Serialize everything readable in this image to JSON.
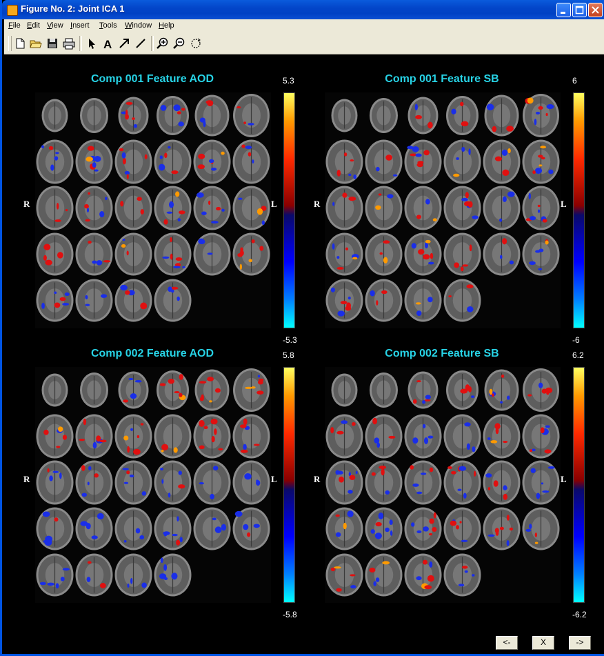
{
  "window": {
    "title": "Figure No. 2: Joint ICA 1"
  },
  "menu": [
    "File",
    "Edit",
    "View",
    "Insert",
    "Tools",
    "Window",
    "Help"
  ],
  "menu_underline": [
    "F",
    "E",
    "V",
    "I",
    "T",
    "W",
    "H"
  ],
  "toolbar": {
    "icons": [
      "new-file-icon",
      "open-folder-icon",
      "save-icon",
      "print-icon",
      "select-arrow-icon",
      "insert-text-icon",
      "insert-arrow-icon",
      "insert-line-icon",
      "zoom-in-icon",
      "zoom-out-icon",
      "rotate-icon"
    ]
  },
  "panels": [
    {
      "title": "Comp 001 Feature AOD",
      "max": "5.3",
      "min": "-5.3",
      "left_label": "R",
      "right_label": "L"
    },
    {
      "title": "Comp 001 Feature SB",
      "max": "6",
      "min": "-6",
      "left_label": "R",
      "right_label": "L"
    },
    {
      "title": "Comp 002 Feature AOD",
      "max": "5.8",
      "min": "-5.8",
      "left_label": "R",
      "right_label": "L"
    },
    {
      "title": "Comp 002 Feature SB",
      "max": "6.2",
      "min": "-6.2",
      "left_label": "R",
      "right_label": "L"
    }
  ],
  "nav": {
    "prev_label": "<-",
    "close_label": "X",
    "next_label": "->"
  },
  "colors": {
    "title_cyan": "#27d3e6",
    "activation_positive": "#e01010",
    "activation_negative": "#1a2ee8",
    "window_blue": "#0054e3"
  }
}
